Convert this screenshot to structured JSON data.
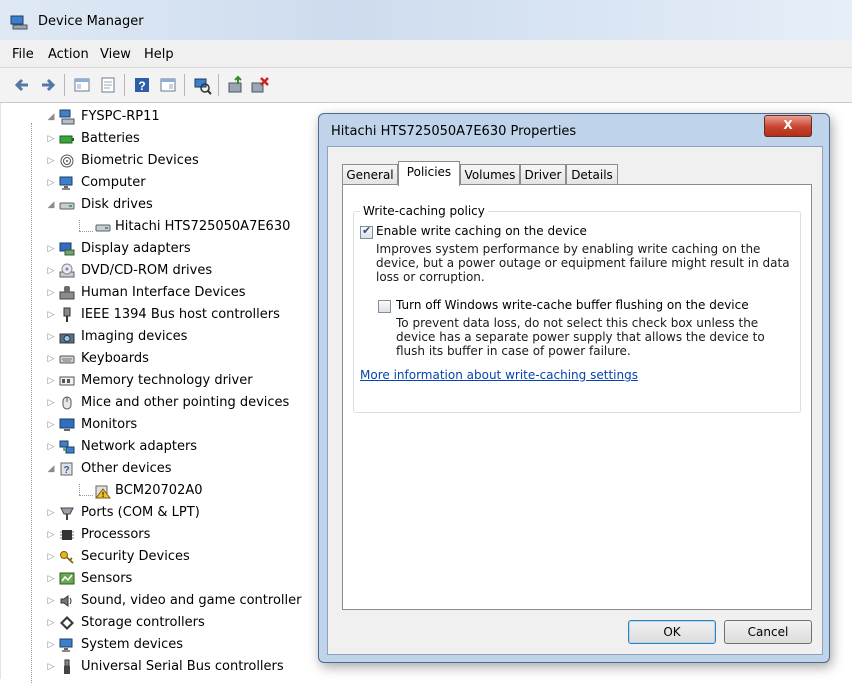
{
  "window": {
    "title": "Device Manager"
  },
  "menu": [
    "File",
    "Action",
    "View",
    "Help"
  ],
  "tree": {
    "root": "FYSPC-RP11",
    "items": [
      {
        "label": "Batteries",
        "expanded": false,
        "icon": "battery-icon"
      },
      {
        "label": "Biometric Devices",
        "expanded": false,
        "icon": "fingerprint-icon"
      },
      {
        "label": "Computer",
        "expanded": false,
        "icon": "computer-icon"
      },
      {
        "label": "Disk drives",
        "expanded": true,
        "icon": "disk-drive-icon",
        "children": [
          "Hitachi HTS725050A7E630"
        ]
      },
      {
        "label": "Display adapters",
        "expanded": false,
        "icon": "display-adapter-icon"
      },
      {
        "label": "DVD/CD-ROM drives",
        "expanded": false,
        "icon": "dvd-drive-icon"
      },
      {
        "label": "Human Interface Devices",
        "expanded": false,
        "icon": "hid-icon"
      },
      {
        "label": "IEEE 1394 Bus host controllers",
        "expanded": false,
        "icon": "ieee1394-icon"
      },
      {
        "label": "Imaging devices",
        "expanded": false,
        "icon": "camera-icon"
      },
      {
        "label": "Keyboards",
        "expanded": false,
        "icon": "keyboard-icon"
      },
      {
        "label": "Memory technology driver",
        "expanded": false,
        "icon": "memory-icon"
      },
      {
        "label": "Mice and other pointing devices",
        "expanded": false,
        "icon": "mouse-icon"
      },
      {
        "label": "Monitors",
        "expanded": false,
        "icon": "monitor-icon"
      },
      {
        "label": "Network adapters",
        "expanded": false,
        "icon": "network-icon"
      },
      {
        "label": "Other devices",
        "expanded": true,
        "icon": "unknown-device-icon",
        "children": [
          "BCM20702A0"
        ]
      },
      {
        "label": "Ports (COM & LPT)",
        "expanded": false,
        "icon": "port-icon"
      },
      {
        "label": "Processors",
        "expanded": false,
        "icon": "processor-icon"
      },
      {
        "label": "Security Devices",
        "expanded": false,
        "icon": "key-icon"
      },
      {
        "label": "Sensors",
        "expanded": false,
        "icon": "sensor-icon"
      },
      {
        "label": "Sound, video and game controller",
        "expanded": false,
        "icon": "speaker-icon"
      },
      {
        "label": "Storage controllers",
        "expanded": false,
        "icon": "storage-icon"
      },
      {
        "label": "System devices",
        "expanded": false,
        "icon": "computer-icon"
      },
      {
        "label": "Universal Serial Bus controllers",
        "expanded": false,
        "icon": "usb-icon"
      }
    ]
  },
  "dialog": {
    "title": "Hitachi HTS725050A7E630 Properties",
    "close_label": "X",
    "tabs": [
      "General",
      "Policies",
      "Volumes",
      "Driver",
      "Details"
    ],
    "active_tab": "Policies",
    "group_label": "Write-caching policy",
    "opt1": {
      "label": "Enable write caching on the device",
      "checked": true,
      "desc": [
        "Improves system performance by enabling write caching on the",
        "device, but a power outage or equipment failure might result in data",
        "loss or corruption."
      ]
    },
    "opt2": {
      "label": "Turn off Windows write-cache buffer flushing on the device",
      "checked": false,
      "desc": [
        "To prevent data loss, do not select this check box unless the",
        "device has a separate power supply that allows the device to",
        "flush its buffer in case of power failure."
      ]
    },
    "link": "More information about write-caching settings",
    "ok": "OK",
    "cancel": "Cancel"
  }
}
